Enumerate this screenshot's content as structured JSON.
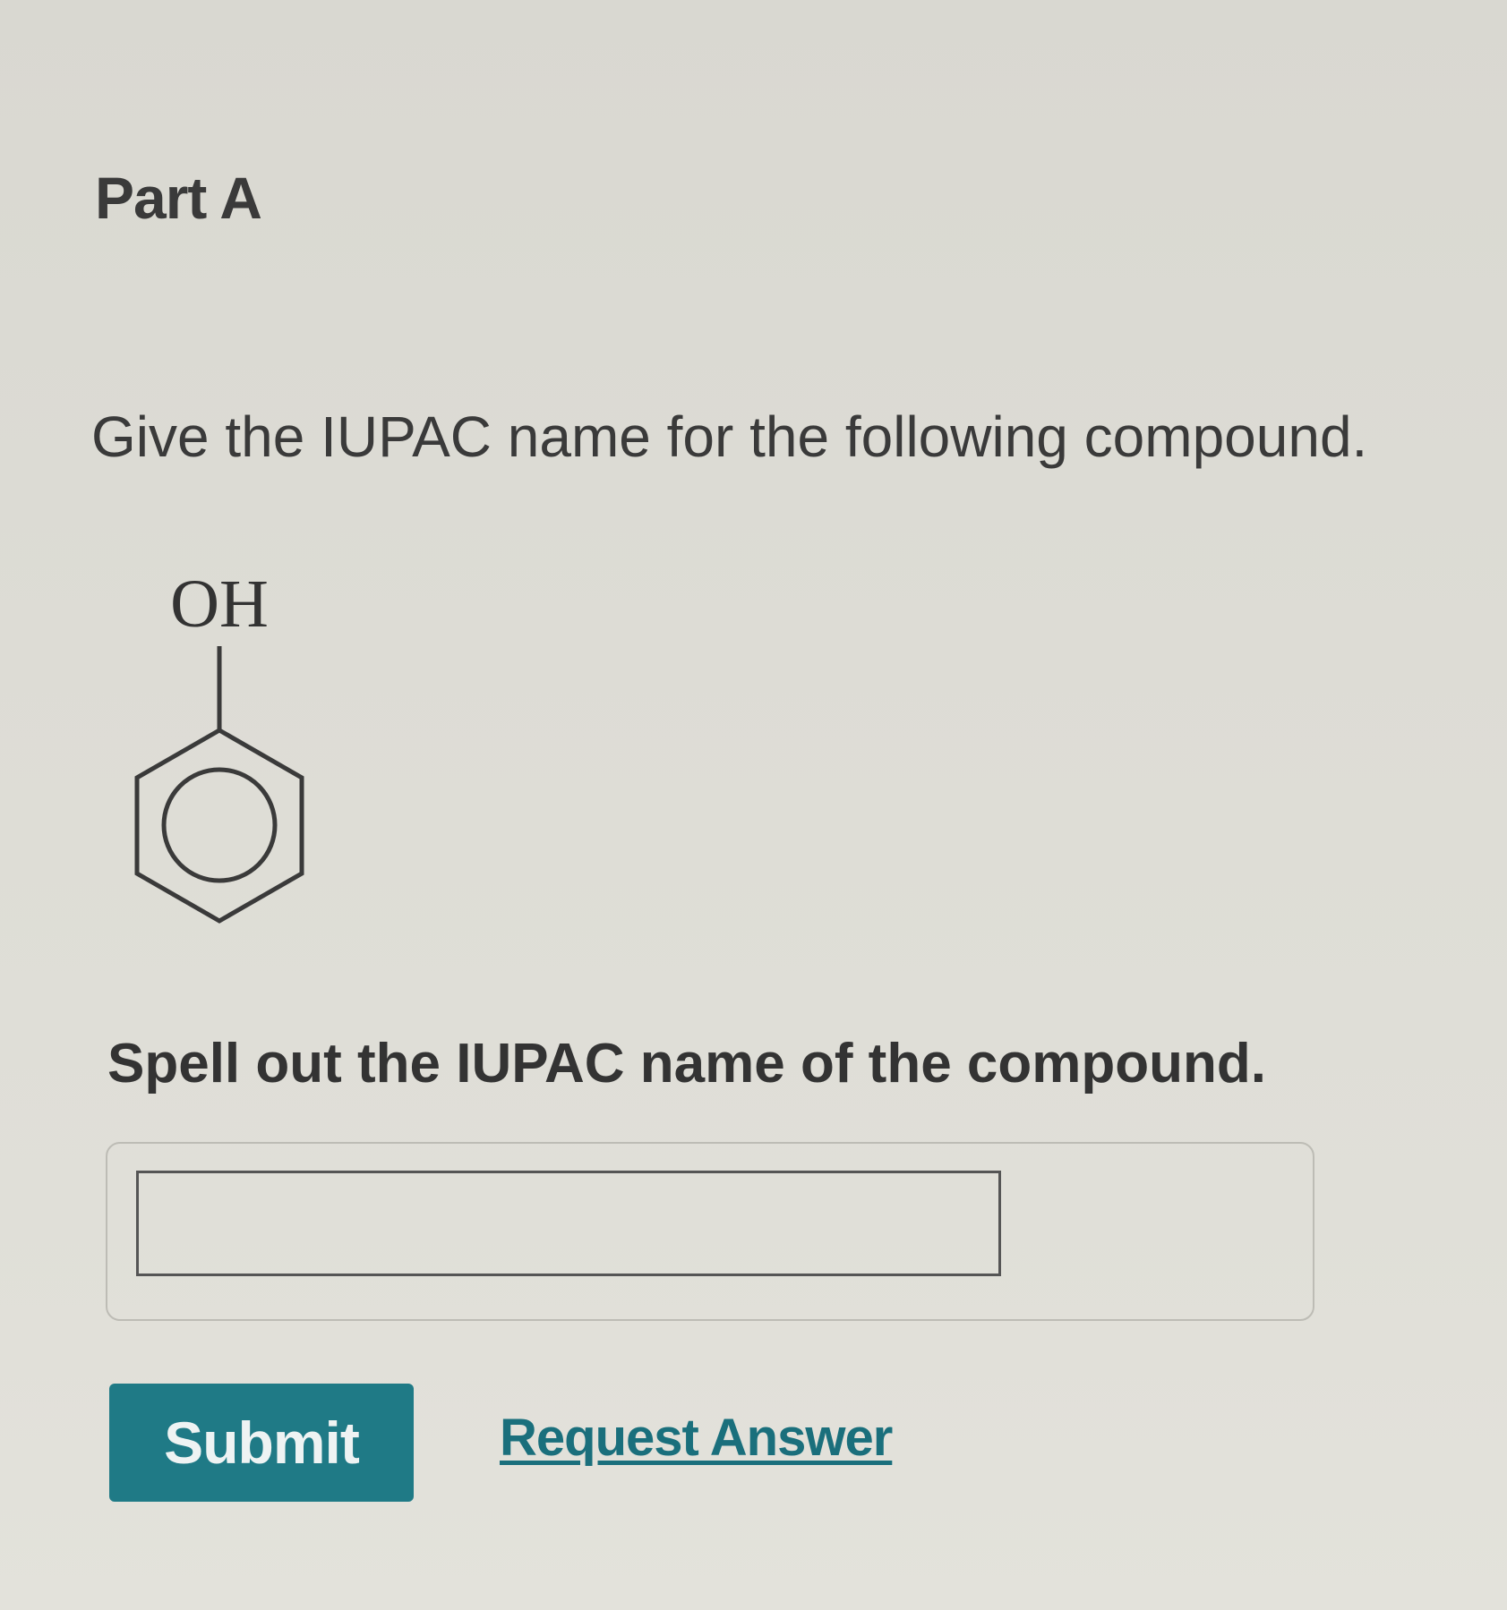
{
  "part": {
    "title": "Part A"
  },
  "question": {
    "prompt": "Give the IUPAC name for the following compound.",
    "substituent_label": "OH"
  },
  "answer": {
    "instruction": "Spell out the IUPAC name of the compound.",
    "value": "",
    "placeholder": ""
  },
  "actions": {
    "submit_label": "Submit",
    "request_answer_label": "Request Answer"
  },
  "colors": {
    "accent": "#1f7a86",
    "link": "#1a6f7c"
  }
}
